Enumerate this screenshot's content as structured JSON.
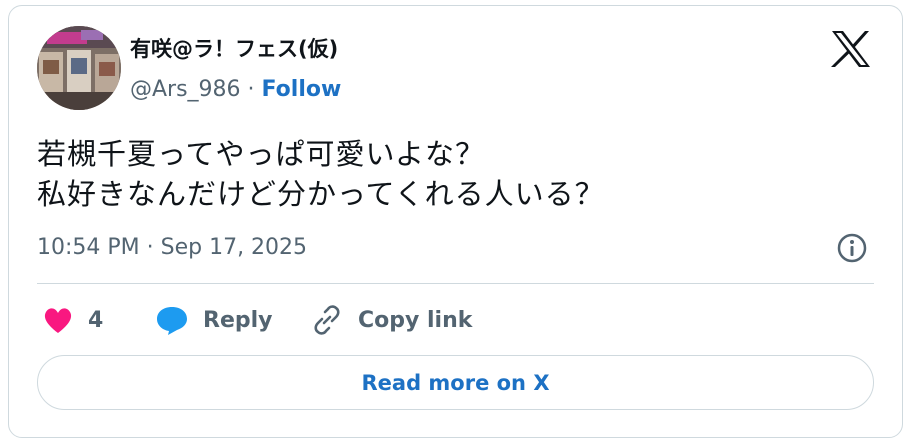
{
  "author": {
    "display_name": "有咲@ラ！フェス(仮)",
    "handle": "@Ars_986",
    "separator": " · ",
    "follow_label": "Follow"
  },
  "tweet": {
    "text_line1": "若槻千夏ってやっぱ可愛いよな？",
    "text_line2": "私好きなんだけど分かってくれる人いる？",
    "timestamp": "10:54 PM · Sep 17, 2025"
  },
  "actions": {
    "like_count": "4",
    "reply_label": "Reply",
    "copy_link_label": "Copy link"
  },
  "footer": {
    "read_more_label": "Read more on X"
  },
  "colors": {
    "like": "#f91880",
    "reply": "#1d9bf0",
    "link": "#1d71c4",
    "muted": "#536471"
  },
  "icons": [
    "x-logo-icon",
    "info-icon",
    "heart-icon",
    "reply-bubble-icon",
    "link-icon"
  ]
}
